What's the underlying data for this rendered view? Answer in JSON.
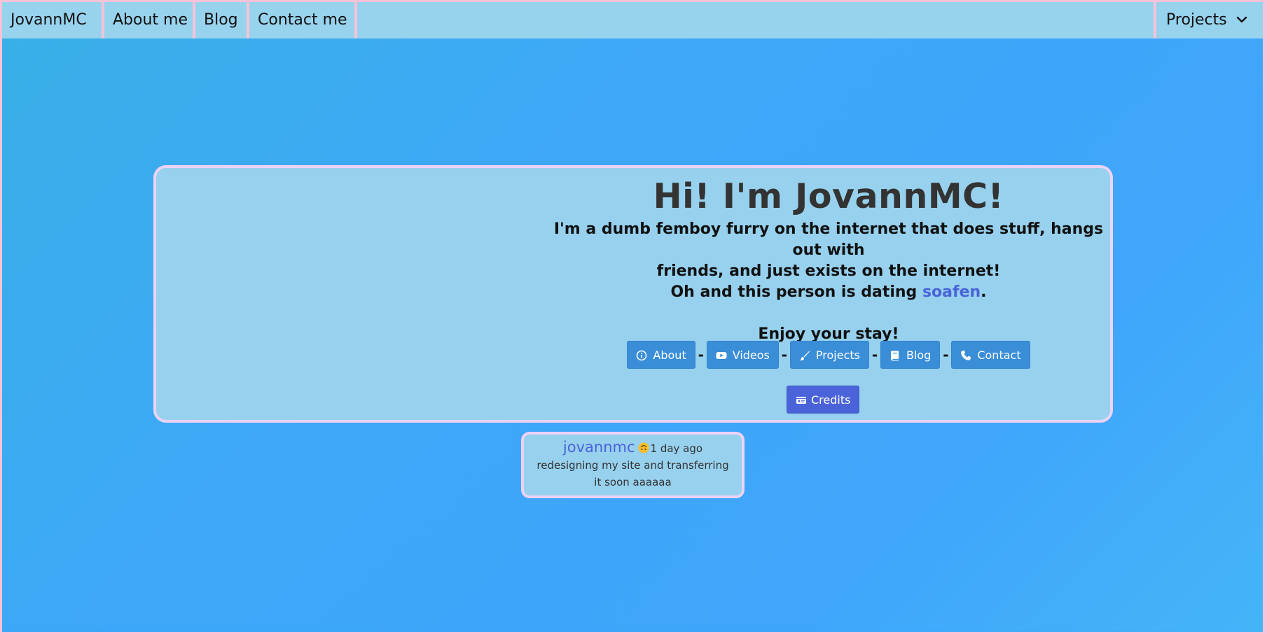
{
  "nav": {
    "home": "JovannMC",
    "about": "About me",
    "blog": "Blog",
    "contact": "Contact me",
    "projects": "Projects"
  },
  "hero": {
    "title": "Hi! I'm JovannMC!",
    "line1": "I'm a dumb femboy furry on the internet that does stuff, hangs out with",
    "line2": "friends, and just exists on the internet!",
    "dating_prefix": "Oh and this person is dating ",
    "dating_link": "soafen",
    "dating_suffix": ".",
    "welcome": "Enjoy your stay!",
    "separator": "-",
    "buttons": [
      {
        "label": "About",
        "icon": "info-icon"
      },
      {
        "label": "Videos",
        "icon": "youtube-icon"
      },
      {
        "label": "Projects",
        "icon": "brush-icon"
      },
      {
        "label": "Blog",
        "icon": "book-icon"
      },
      {
        "label": "Contact",
        "icon": "phone-icon"
      }
    ],
    "credits": {
      "label": "Credits",
      "icon": "id-card-icon"
    }
  },
  "status": {
    "username": "jovannmc",
    "emoji": "upside-down-face-icon",
    "time": "1 day ago",
    "text": "redesigning my site and transferring it soon aaaaaa"
  },
  "colors": {
    "page_border": "#f6c3d8",
    "navbar": "#98d3ee",
    "card": "#97d1ee",
    "card_border": "#ecd2f4",
    "button": "#3a8ed8",
    "credits_button": "#4b63d8",
    "link": "#4b63d8"
  }
}
